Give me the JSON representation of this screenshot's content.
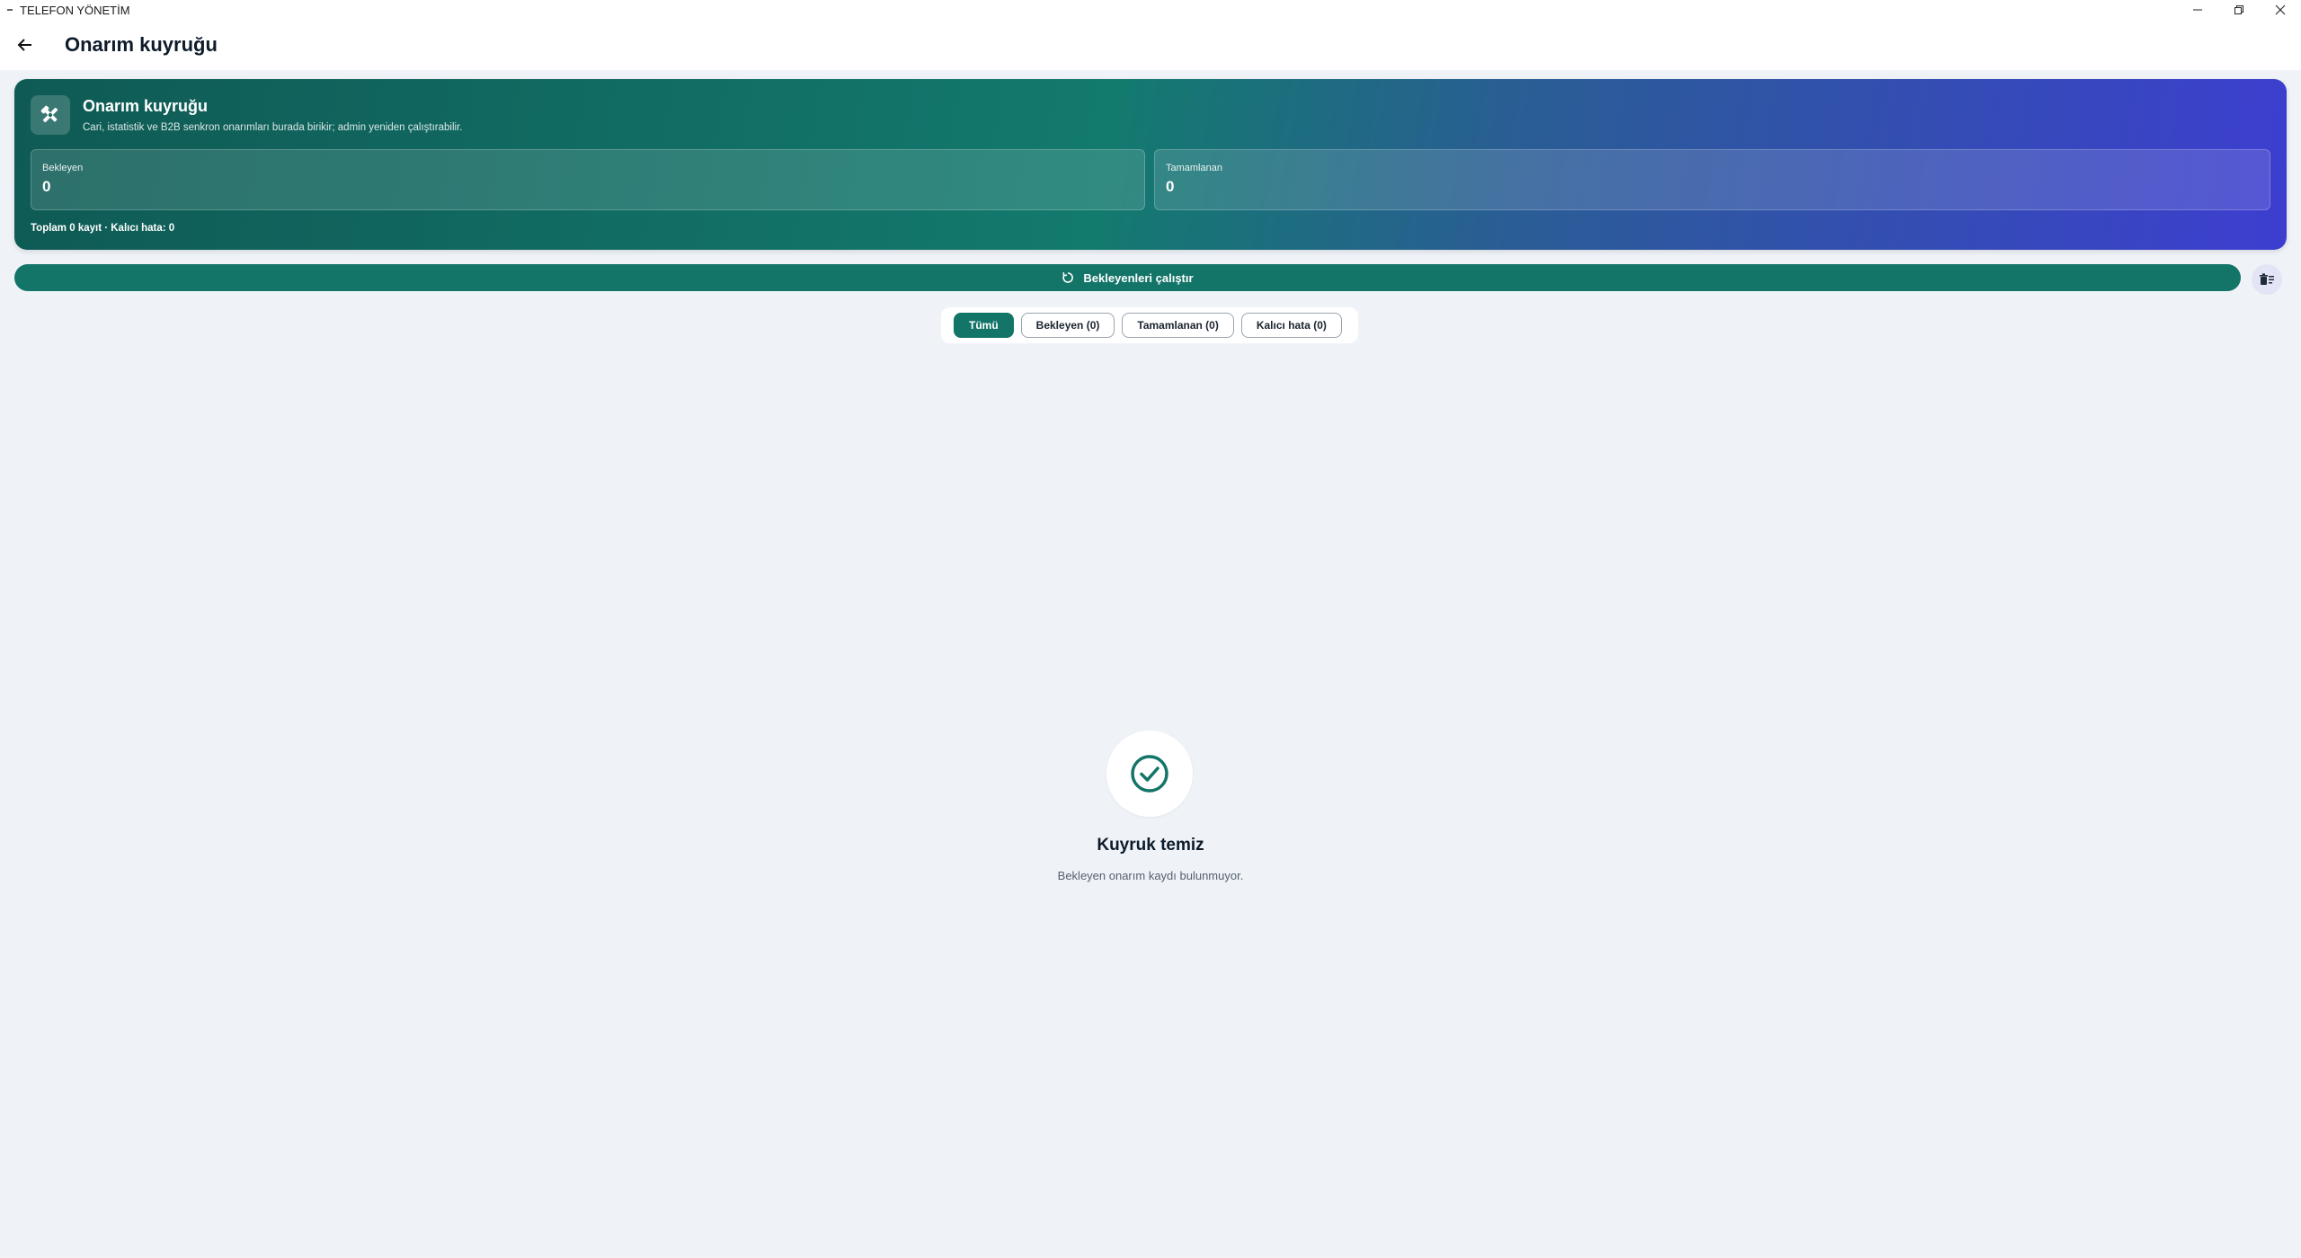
{
  "window": {
    "title": "TELEFON YÖNETİM",
    "controls": [
      "minimize-icon",
      "restore-icon",
      "close-icon"
    ]
  },
  "appbar": {
    "back_icon": "arrow-left-icon",
    "title": "Onarım kuyruğu"
  },
  "hero": {
    "icon": "tools-icon",
    "title": "Onarım kuyruğu",
    "subtitle": "Cari, istatistik ve B2B senkron onarımları burada birikir; admin yeniden çalıştırabilir.",
    "stats": [
      {
        "label": "Bekleyen",
        "value": "0"
      },
      {
        "label": "Tamamlanan",
        "value": "0"
      }
    ],
    "footer": "Toplam 0 kayıt · Kalıcı hata: 0"
  },
  "actions": {
    "run_label": "Bekleyenleri çalıştır",
    "run_icon": "refresh-icon",
    "clear_icon": "clear-list-icon"
  },
  "filters": [
    {
      "label": "Tümü",
      "active": true
    },
    {
      "label": "Bekleyen (0)",
      "active": false
    },
    {
      "label": "Tamamlanan (0)",
      "active": false
    },
    {
      "label": "Kalıcı hata (0)",
      "active": false
    }
  ],
  "empty_state": {
    "icon": "check-circle-icon",
    "title": "Kuyruk temiz",
    "subtitle": "Bekleyen onarım kaydı bulunmuyor."
  },
  "colors": {
    "primary": "#137468",
    "background": "#eff3f8",
    "hero_gradient_start": "#0f5a55",
    "hero_gradient_end": "#3d3ed0"
  }
}
